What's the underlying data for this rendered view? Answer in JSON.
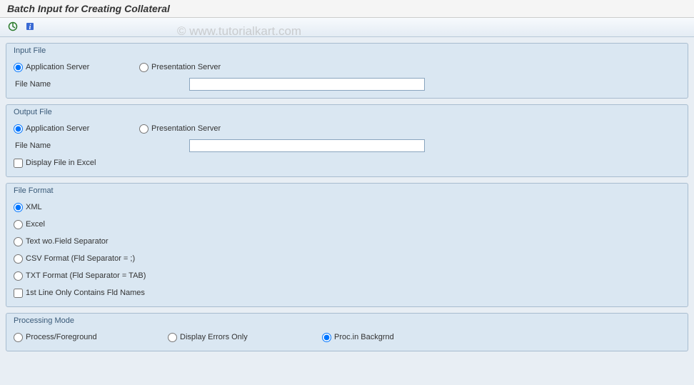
{
  "title": "Batch Input for Creating Collateral",
  "watermark": "© www.tutorialkart.com",
  "toolbar": {
    "execute_name": "execute-icon",
    "info_name": "info-icon"
  },
  "input_file": {
    "heading": "Input File",
    "app_server": "Application Server",
    "pres_server": "Presentation Server",
    "file_name_label": "File Name",
    "file_name_value": ""
  },
  "output_file": {
    "heading": "Output File",
    "app_server": "Application Server",
    "pres_server": "Presentation Server",
    "file_name_label": "File Name",
    "file_name_value": "",
    "display_excel": "Display File in Excel"
  },
  "file_format": {
    "heading": "File Format",
    "xml": "XML",
    "excel": "Excel",
    "text_wo": "Text wo.Field Separator",
    "csv": "CSV Format (Fld Separator = ;)",
    "txt": "TXT Format (Fld Separator = TAB)",
    "first_line": "1st Line Only Contains Fld Names"
  },
  "processing_mode": {
    "heading": "Processing Mode",
    "foreground": "Process/Foreground",
    "errors": "Display Errors Only",
    "background": "Proc.in Backgrnd"
  }
}
